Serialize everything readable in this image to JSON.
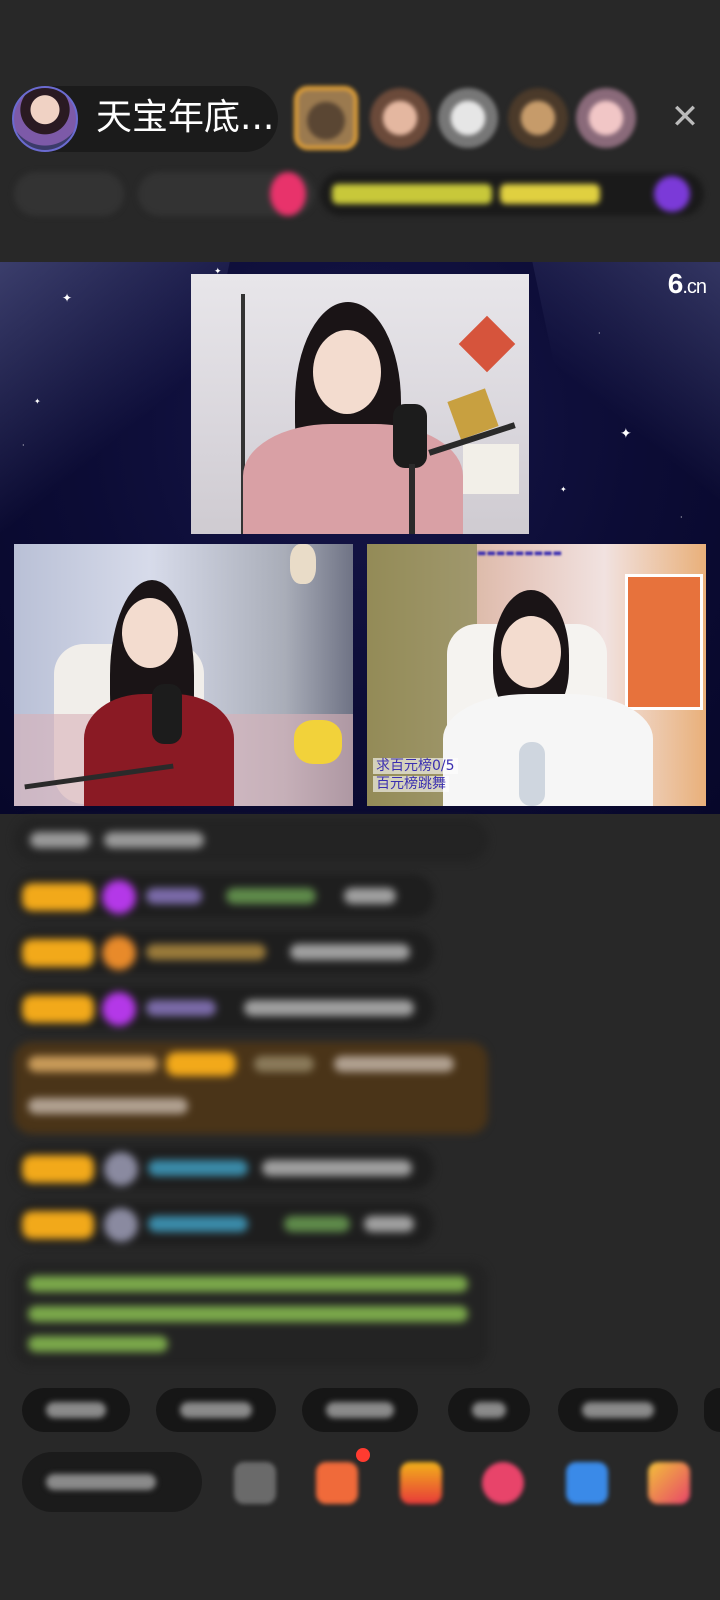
{
  "header": {
    "host_name": "天宝年底...",
    "close_symbol": "✕"
  },
  "stage": {
    "logo_main": "6",
    "logo_suffix": ".cn",
    "cam_right_caption_1": "求百元榜0/5",
    "cam_right_caption_2": "百元榜跳舞"
  },
  "colors": {
    "background": "#282828",
    "stage_bg": "#0c0c35",
    "badge_gold": "#f2a91a",
    "gem_purple": "#b438e8"
  }
}
